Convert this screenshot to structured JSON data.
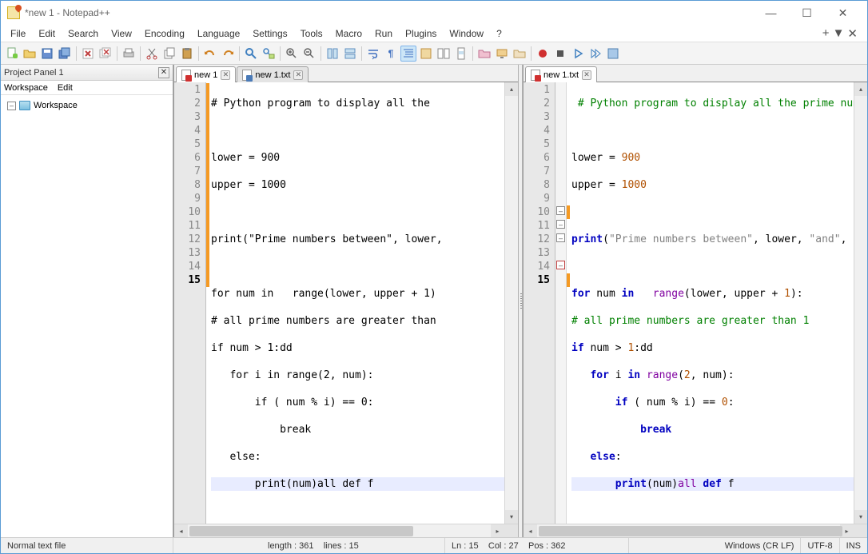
{
  "window": {
    "title": "*new 1 - Notepad++"
  },
  "menu": {
    "items": [
      "File",
      "Edit",
      "Search",
      "View",
      "Encoding",
      "Language",
      "Settings",
      "Tools",
      "Macro",
      "Run",
      "Plugins",
      "Window",
      "?"
    ]
  },
  "project_panel": {
    "title": "Project Panel 1",
    "menu": [
      "Workspace",
      "Edit"
    ],
    "root": "Workspace"
  },
  "left_pane": {
    "tabs": [
      {
        "label": "new 1",
        "unsaved": true,
        "active": true
      },
      {
        "label": "new 1.txt",
        "unsaved": false,
        "active": false
      }
    ],
    "lines": {
      "l1": "# Python program to display all the ",
      "l2": "",
      "l3": "lower = 900",
      "l4": "upper = 1000",
      "l5": "",
      "l6": "print(\"Prime numbers between\", lower,",
      "l7": "",
      "l8": "for num in   range(lower, upper + 1)",
      "l9": "# all prime numbers are greater than ",
      "l10": "if num > 1:dd",
      "l11": "   for i in range(2, num):",
      "l12": "       if ( num % i) == 0:",
      "l13": "           break",
      "l14": "   else:",
      "l15": "       print(num)all def f"
    }
  },
  "right_pane": {
    "tabs": [
      {
        "label": "new 1.txt",
        "unsaved": true,
        "active": true
      }
    ],
    "lines": {
      "l1": " # Python program to display all the prime numbers ",
      "l2": "",
      "l3": "lower = 900",
      "l4": "upper = 1000",
      "l5": "",
      "l6": "print(\"Prime numbers between\", lower, \"and\", upper",
      "l7": "",
      "l8": "for num in   range(lower, upper + 1):",
      "l9": "# all prime numbers are greater than 1",
      "l10": "if num > 1:dd",
      "l11": "   for i in range(2, num):",
      "l12": "       if ( num % i) == 0:",
      "l13": "           break",
      "l14": "   else:",
      "l15": "       print(num)all def f"
    }
  },
  "status": {
    "doc_type": "Normal text file",
    "length": "length : 361",
    "lines": "lines : 15",
    "ln": "Ln : 15",
    "col": "Col : 27",
    "pos": "Pos : 362",
    "eol": "Windows (CR LF)",
    "enc": "UTF-8",
    "ins": "INS"
  }
}
